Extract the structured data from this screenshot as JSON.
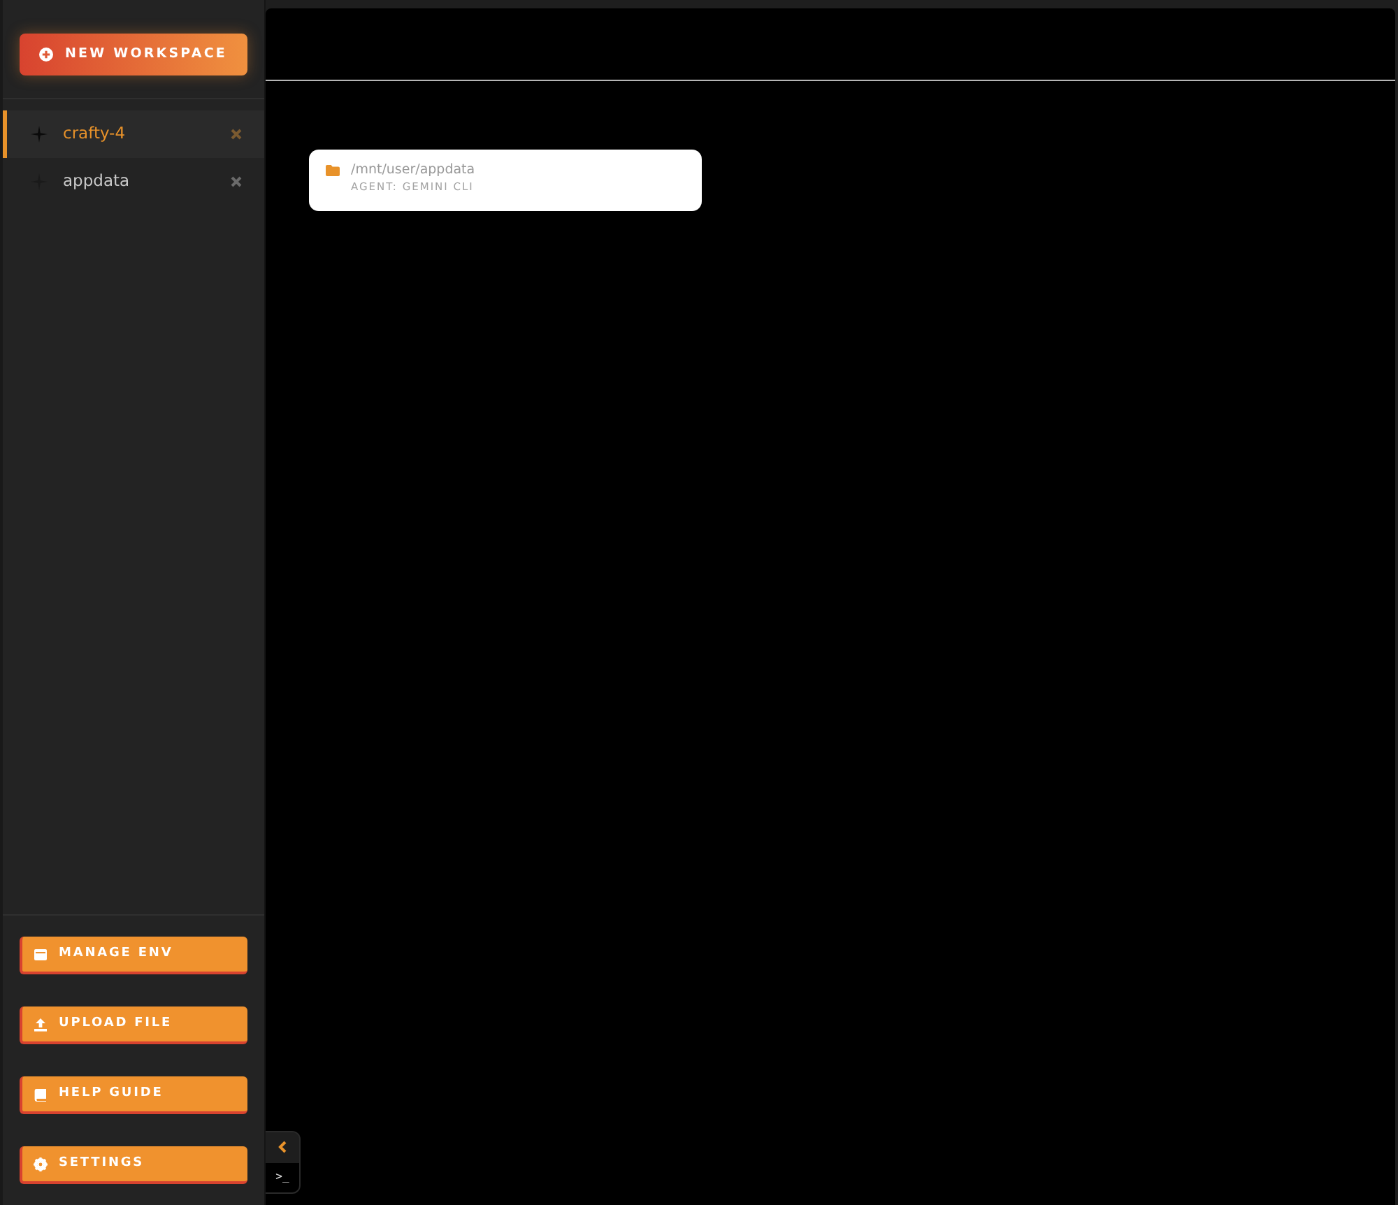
{
  "sidebar": {
    "new_workspace_button": {
      "label": "NEW WORKSPACE"
    },
    "workspaces": [
      {
        "label": "crafty-4",
        "selected": true
      },
      {
        "label": "appdata",
        "selected": false
      }
    ],
    "actions": [
      {
        "kind": "env",
        "label": "MANAGE ENV"
      },
      {
        "kind": "upload",
        "label": "UPLOAD FILE"
      },
      {
        "kind": "guide",
        "label": "HELP GUIDE"
      },
      {
        "kind": "settings",
        "label": "SETTINGS"
      }
    ]
  },
  "main": {
    "sessions": [
      {
        "path": "/mnt/user/appdata",
        "agent": "AGENT: GEMINI CLI"
      }
    ]
  },
  "panel_toggle": {
    "terminal": ">_"
  }
}
